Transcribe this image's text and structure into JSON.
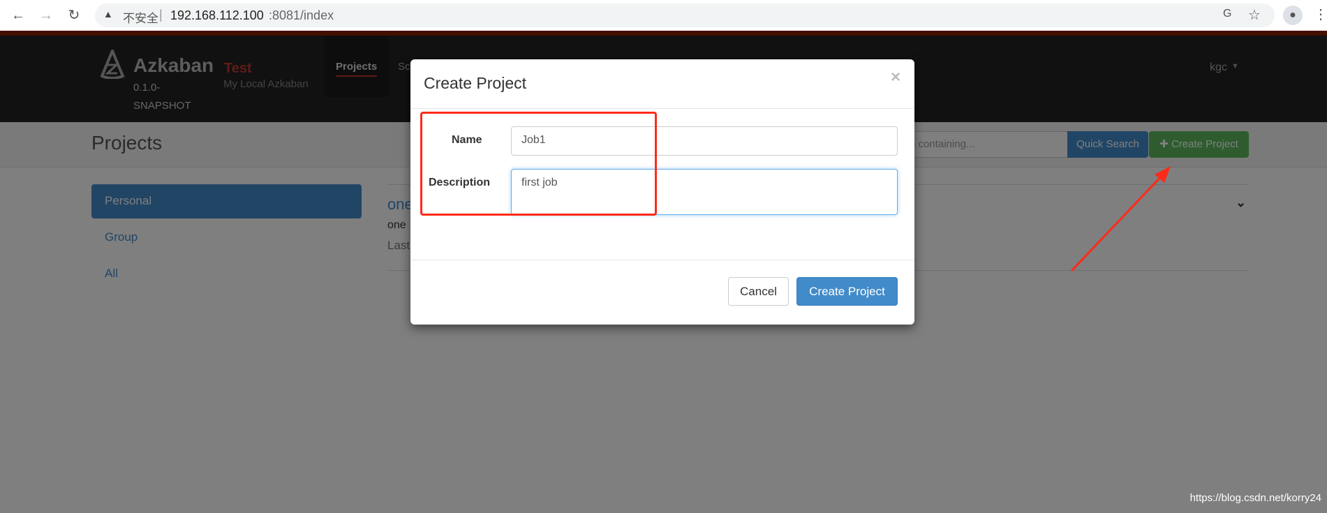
{
  "browser": {
    "security_label": "不安全",
    "url_host": "192.168.112.100",
    "url_port_path": ":8081/index"
  },
  "header": {
    "brand": "Azkaban",
    "version_line1": "0.1.0-",
    "version_line2": "SNAPSHOT",
    "env_name": "Test",
    "env_desc": "My Local Azkaban",
    "nav": [
      "Projects",
      "Sc"
    ],
    "user": "kgc"
  },
  "subheader": {
    "title": "Projects",
    "search_placeholder": "e containing...",
    "quick_search": "Quick Search",
    "create_project": "Create Project"
  },
  "sidebar": {
    "items": [
      {
        "label": "Personal",
        "active": true
      },
      {
        "label": "Group"
      },
      {
        "label": "All"
      }
    ]
  },
  "projects": {
    "name": "one",
    "description": "one",
    "modified": "Last"
  },
  "modal": {
    "title": "Create Project",
    "close": "×",
    "name_label": "Name",
    "name_value": "Job1",
    "desc_label": "Description",
    "desc_value": "first job",
    "cancel": "Cancel",
    "submit": "Create Project"
  },
  "watermark": "https://blog.csdn.net/korry24",
  "colors": {
    "accent_red": "#ff2a1a",
    "primary": "#428bca",
    "success": "#5cb85c",
    "brand_red": "#c0392b"
  }
}
